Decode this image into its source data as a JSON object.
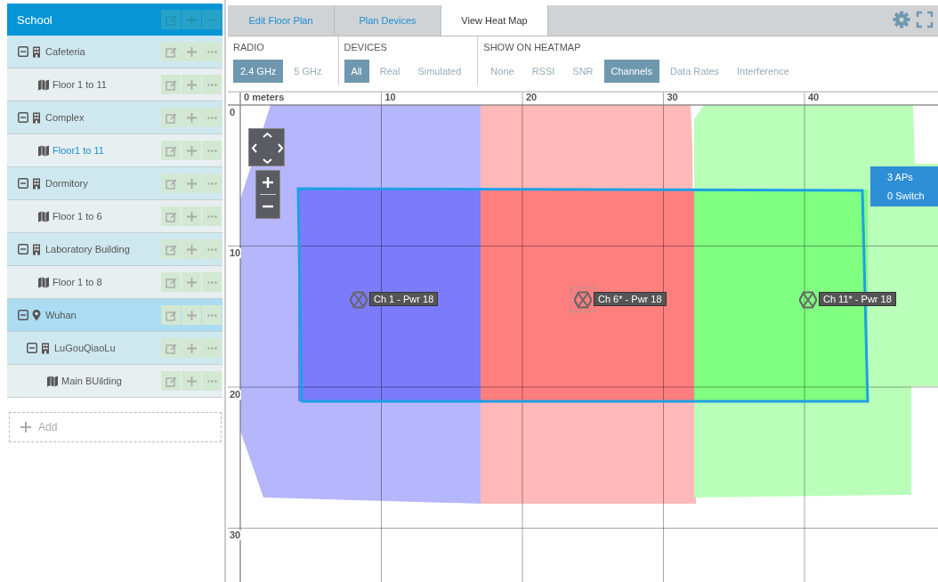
{
  "tree": {
    "title": "School",
    "children": [
      {
        "label": "Cafeteria",
        "kind": "building",
        "expanded": true,
        "selected": false,
        "hovered": false,
        "children": [
          {
            "label": "Floor 1 to 11",
            "kind": "floor",
            "selected": false,
            "hovered": false
          }
        ]
      },
      {
        "label": "Complex",
        "kind": "building",
        "expanded": true,
        "selected": false,
        "hovered": false,
        "children": [
          {
            "label": "Floor1 to 11",
            "kind": "floor",
            "selected": true,
            "hovered": false
          }
        ]
      },
      {
        "label": "Dormitory",
        "kind": "building",
        "expanded": true,
        "selected": false,
        "hovered": false,
        "children": [
          {
            "label": "Floor 1 to 6",
            "kind": "floor",
            "selected": false,
            "hovered": false
          }
        ]
      },
      {
        "label": "Laboratory Building",
        "kind": "building",
        "expanded": true,
        "selected": false,
        "hovered": false,
        "children": [
          {
            "label": "Floor 1 to 8",
            "kind": "floor",
            "selected": false,
            "hovered": false
          }
        ]
      },
      {
        "label": "Wuhan",
        "kind": "location",
        "expanded": true,
        "selected": false,
        "hovered": true,
        "children": [
          {
            "label": "LuGouQiaoLu",
            "kind": "building",
            "expanded": true,
            "selected": false,
            "hovered": false,
            "children": [
              {
                "label": "Main BUilding",
                "kind": "floor",
                "selected": false,
                "hovered": false
              }
            ]
          }
        ]
      }
    ]
  },
  "add_button": "Add",
  "tabs": [
    {
      "label": "Edit Floor Plan",
      "selected": false
    },
    {
      "label": "Plan Devices",
      "selected": false
    },
    {
      "label": "View Heat Map",
      "selected": true
    }
  ],
  "toolbar": [
    {
      "label": "RADIO",
      "options": [
        {
          "label": "2.4 GHz",
          "selected": true
        },
        {
          "label": "5 GHz",
          "selected": false
        }
      ]
    },
    {
      "label": "DEVICES",
      "options": [
        {
          "label": "All",
          "selected": true
        },
        {
          "label": "Real",
          "selected": false
        },
        {
          "label": "Simulated",
          "selected": false
        }
      ]
    },
    {
      "label": "SHOW ON HEATMAP",
      "options": [
        {
          "label": "None",
          "selected": false
        },
        {
          "label": "RSSI",
          "selected": false
        },
        {
          "label": "SNR",
          "selected": false
        },
        {
          "label": "Channels",
          "selected": true
        },
        {
          "label": "Data Rates",
          "selected": false
        },
        {
          "label": "Interference",
          "selected": false
        }
      ]
    }
  ],
  "ruler": {
    "x_labels": [
      "0 meters",
      "10",
      "20",
      "30",
      "40"
    ],
    "y_labels": [
      "0",
      "10",
      "20",
      "30"
    ]
  },
  "aps": [
    {
      "label": "Ch 1 - Pwr 18",
      "color": "#7b7bfb",
      "selected": false
    },
    {
      "label": "Ch 6* - Pwr 18",
      "color": "#ff7f7f",
      "selected": true
    },
    {
      "label": "Ch 11* - Pwr 18",
      "color": "#80ff80",
      "selected": false
    }
  ],
  "map_info": [
    "3 APs",
    "0 Switch"
  ]
}
